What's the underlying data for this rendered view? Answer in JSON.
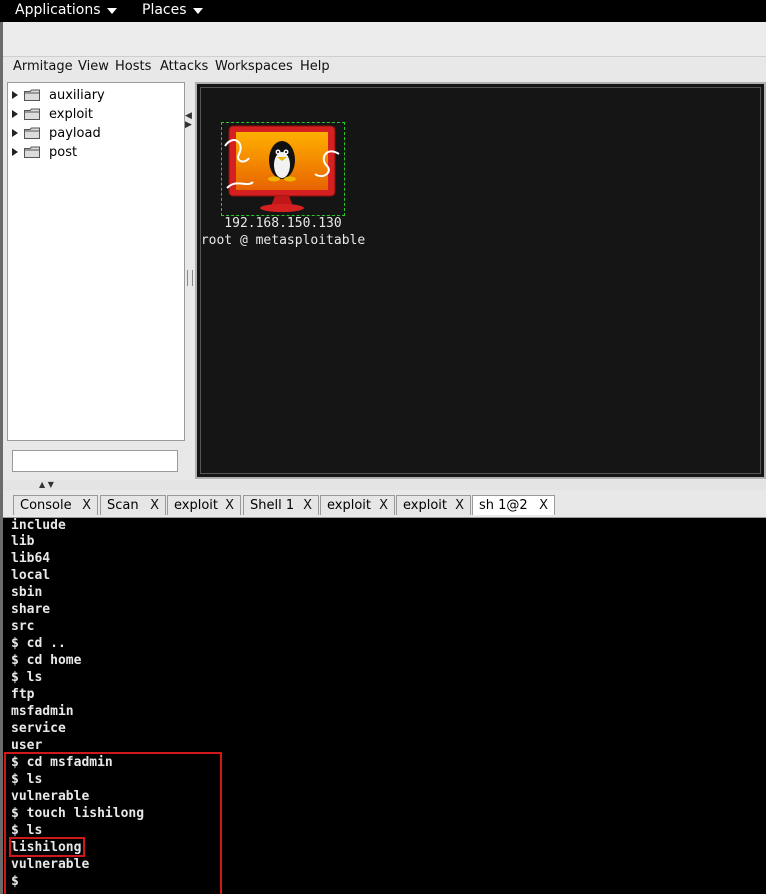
{
  "topbar": {
    "applications": "Applications",
    "places": "Places"
  },
  "menubar": {
    "items": [
      "Armitage",
      "View",
      "Hosts",
      "Attacks",
      "Workspaces",
      "Help"
    ]
  },
  "tree": {
    "items": [
      "auxiliary",
      "exploit",
      "payload",
      "post"
    ]
  },
  "host": {
    "ip": "192.168.150.130",
    "label": "root @ metasploitable",
    "os_icon": "linux-penguin-icon"
  },
  "tabs": [
    {
      "label": "Console",
      "close": "X"
    },
    {
      "label": "Scan",
      "close": "X"
    },
    {
      "label": "exploit",
      "close": "X"
    },
    {
      "label": "Shell 1",
      "close": "X"
    },
    {
      "label": "exploit",
      "close": "X"
    },
    {
      "label": "exploit",
      "close": "X"
    },
    {
      "label": "sh 1@2",
      "close": "X"
    }
  ],
  "console": {
    "lines": [
      "include",
      "lib",
      "lib64",
      "local",
      "sbin",
      "share",
      "src",
      "$ cd ..",
      "$ cd home",
      "$ ls",
      "ftp",
      "msfadmin",
      "service",
      "user",
      "$ cd msfadmin",
      "$ ls",
      "vulnerable",
      "$ touch lishilong",
      "$ ls",
      "lishilong",
      "vulnerable",
      "$"
    ]
  },
  "colors": {
    "highlight": "#d01818",
    "selection": "#28c828",
    "console_bg": "#000000",
    "graph_bg": "#151515"
  }
}
